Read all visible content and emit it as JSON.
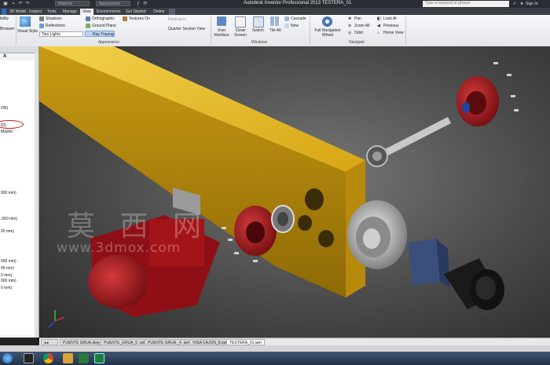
{
  "titlebar": {
    "title": "Autodesk Inventor Professional 2013    TESTERA_01",
    "dropdown_material": "Material",
    "dropdown_appearance": "Appearance",
    "search_placeholder": "Type a keyword or phrase",
    "sign_in": "Sign In"
  },
  "tabs": [
    "3D Model",
    "Inspect",
    "Tools",
    "Manage",
    "View",
    "Environments",
    "Get Started",
    "Online"
  ],
  "active_tab": "View",
  "ribbon": {
    "visibility_partial": "ibility",
    "browser_partial": "Browser",
    "visual_style": "Visual Style",
    "shadows": "Shadows",
    "reflections": "Reflections",
    "lights": "Two Lights",
    "orthographic": "Orthographic",
    "ground_plane": "Ground Plane",
    "ray_tracing": "Ray Tracing",
    "textures_on": "Textures On",
    "illustration": "Illustration",
    "quarter_section": "Quarter Section View",
    "appearance_panel": "Appearance",
    "user_interface": "User Interface",
    "clean_screen": "Clean Screen",
    "switch": "Switch",
    "tile_all": "Tile All",
    "cascade": "Cascade",
    "new": "New",
    "windows_panel": "Windows",
    "full_navigation_wheel": "Full Navigation Wheel",
    "pan": "Pan",
    "zoom_all": "Zoom All",
    "orbit": "Orbit",
    "look_at": "Look At",
    "previous": "Previous",
    "home_view": "Home View",
    "navigate_panel": "Navigate"
  },
  "browser": {
    "header_icon": "A",
    "lines": [
      "ON)",
      "ID)",
      "Master",
      "000 mm)",
      ",000 mm)",
      "00 mm)",
      "000 mm)",
      "00 mm)",
      "0 mm)",
      "000 mm)",
      "0 mm)"
    ]
  },
  "watermark": {
    "cn": "莫 西 网",
    "url": "www.3dmox.com"
  },
  "doc_tabs": [
    "PUENTE GRUA.dwg",
    "PUENTE_GRUA_5 .iam",
    "PUENTE GRUA _4 .iam",
    "VIGA CAJON_8.iam",
    "TESTERA_01.iam"
  ],
  "active_doc_tab": "TESTERA_01.iam",
  "colors": {
    "beam_yellow": "#e3b81f",
    "motor_red": "#a8141b",
    "ribbon_bg": "#eceef1",
    "titlebar_bg": "#2a2d33",
    "highlight": "#bcd6f2"
  }
}
